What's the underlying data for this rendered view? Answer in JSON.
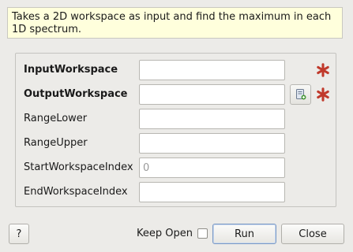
{
  "description": "Takes a 2D workspace as input and find the maximum in each 1D spectrum.",
  "properties": [
    {
      "label": "InputWorkspace",
      "bold": true,
      "value": "",
      "placeholder": "",
      "mandatory": true,
      "browse": false
    },
    {
      "label": "OutputWorkspace",
      "bold": true,
      "value": "",
      "placeholder": "",
      "mandatory": true,
      "browse": true
    },
    {
      "label": "RangeLower",
      "bold": false,
      "value": "",
      "placeholder": "",
      "mandatory": false,
      "browse": false
    },
    {
      "label": "RangeUpper",
      "bold": false,
      "value": "",
      "placeholder": "",
      "mandatory": false,
      "browse": false
    },
    {
      "label": "StartWorkspaceIndex",
      "bold": false,
      "value": "",
      "placeholder": "0",
      "mandatory": false,
      "browse": false
    },
    {
      "label": "EndWorkspaceIndex",
      "bold": false,
      "value": "",
      "placeholder": "",
      "mandatory": false,
      "browse": false
    }
  ],
  "footer": {
    "help_label": "?",
    "keep_open_label": "Keep Open",
    "keep_open_checked": false,
    "run_label": "Run",
    "close_label": "Close"
  },
  "colors": {
    "mandatory_star": "#c0392b",
    "description_bg": "#ffffdc"
  },
  "icons": {
    "mandatory": "asterisk-icon",
    "browse": "workspace-browse-icon"
  }
}
